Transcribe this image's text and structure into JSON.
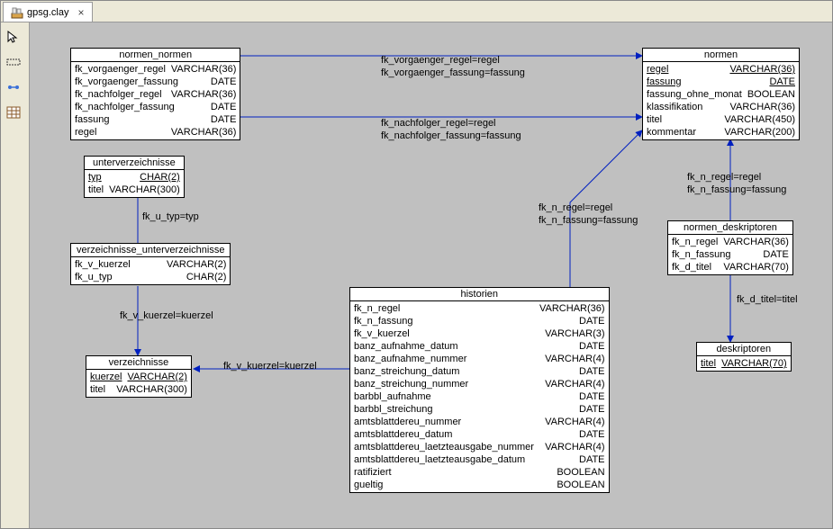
{
  "tab": {
    "title": "gpsg.clay",
    "close_label": "×"
  },
  "toolbar": {
    "pointer": "pointer-tool",
    "marquee": "marquee-tool",
    "link": "link-tool",
    "table": "table-tool"
  },
  "entities": {
    "normen_normen": {
      "title": "normen_normen",
      "rows": [
        {
          "name": "fk_vorgaenger_regel",
          "type": "VARCHAR(36)",
          "pk": false
        },
        {
          "name": "fk_vorgaenger_fassung",
          "type": "DATE",
          "pk": false
        },
        {
          "name": "fk_nachfolger_regel",
          "type": "VARCHAR(36)",
          "pk": false
        },
        {
          "name": "fk_nachfolger_fassung",
          "type": "DATE",
          "pk": false
        },
        {
          "name": "fassung",
          "type": "DATE",
          "pk": false
        },
        {
          "name": "regel",
          "type": "VARCHAR(36)",
          "pk": false
        }
      ]
    },
    "normen": {
      "title": "normen",
      "rows": [
        {
          "name": "regel",
          "type": "VARCHAR(36)",
          "pk": true
        },
        {
          "name": "fassung",
          "type": "DATE",
          "pk": true
        },
        {
          "name": "fassung_ohne_monat",
          "type": "BOOLEAN",
          "pk": false
        },
        {
          "name": "klassifikation",
          "type": "VARCHAR(36)",
          "pk": false
        },
        {
          "name": "titel",
          "type": "VARCHAR(450)",
          "pk": false
        },
        {
          "name": "kommentar",
          "type": "VARCHAR(200)",
          "pk": false
        }
      ]
    },
    "unterverzeichnisse": {
      "title": "unterverzeichnisse",
      "rows": [
        {
          "name": "typ",
          "type": "CHAR(2)",
          "pk": true
        },
        {
          "name": "titel",
          "type": "VARCHAR(300)",
          "pk": false
        }
      ]
    },
    "verzeichnisse_unterverzeichnisse": {
      "title": "verzeichnisse_unterverzeichnisse",
      "rows": [
        {
          "name": "fk_v_kuerzel",
          "type": "VARCHAR(2)",
          "pk": false
        },
        {
          "name": "fk_u_typ",
          "type": "CHAR(2)",
          "pk": false
        }
      ]
    },
    "verzeichnisse": {
      "title": "verzeichnisse",
      "rows": [
        {
          "name": "kuerzel",
          "type": "VARCHAR(2)",
          "pk": true
        },
        {
          "name": "titel",
          "type": "VARCHAR(300)",
          "pk": false
        }
      ]
    },
    "normen_deskriptoren": {
      "title": "normen_deskriptoren",
      "rows": [
        {
          "name": "fk_n_regel",
          "type": "VARCHAR(36)",
          "pk": false
        },
        {
          "name": "fk_n_fassung",
          "type": "DATE",
          "pk": false
        },
        {
          "name": "fk_d_titel",
          "type": "VARCHAR(70)",
          "pk": false
        }
      ]
    },
    "deskriptoren": {
      "title": "deskriptoren",
      "rows": [
        {
          "name": "titel",
          "type": "VARCHAR(70)",
          "pk": true
        }
      ]
    },
    "historien": {
      "title": "historien",
      "rows": [
        {
          "name": "fk_n_regel",
          "type": "VARCHAR(36)",
          "pk": false
        },
        {
          "name": "fk_n_fassung",
          "type": "DATE",
          "pk": false
        },
        {
          "name": "fk_v_kuerzel",
          "type": "VARCHAR(3)",
          "pk": false
        },
        {
          "name": "banz_aufnahme_datum",
          "type": "DATE",
          "pk": false
        },
        {
          "name": "banz_aufnahme_nummer",
          "type": "VARCHAR(4)",
          "pk": false
        },
        {
          "name": "banz_streichung_datum",
          "type": "DATE",
          "pk": false
        },
        {
          "name": "banz_streichung_nummer",
          "type": "VARCHAR(4)",
          "pk": false
        },
        {
          "name": "barbbl_aufnahme",
          "type": "DATE",
          "pk": false
        },
        {
          "name": "barbbl_streichung",
          "type": "DATE",
          "pk": false
        },
        {
          "name": "amtsblattdereu_nummer",
          "type": "VARCHAR(4)",
          "pk": false
        },
        {
          "name": "amtsblattdereu_datum",
          "type": "DATE",
          "pk": false
        },
        {
          "name": "amtsblattdereu_laetzteausgabe_nummer",
          "type": "VARCHAR(4)",
          "pk": false
        },
        {
          "name": "amtsblattdereu_laetzteausgabe_datum",
          "type": "DATE",
          "pk": false
        },
        {
          "name": "ratifiziert",
          "type": "BOOLEAN",
          "pk": false
        },
        {
          "name": "gueltig",
          "type": "BOOLEAN",
          "pk": false
        }
      ]
    }
  },
  "rel_labels": {
    "r1a": "fk_vorgaenger_regel=regel",
    "r1b": "fk_vorgaenger_fassung=fassung",
    "r2a": "fk_nachfolger_regel=regel",
    "r2b": "fk_nachfolger_fassung=fassung",
    "r3": "fk_u_typ=typ",
    "r4": "fk_v_kuerzel=kuerzel",
    "r5": "fk_v_kuerzel=kuerzel",
    "r6a": "fk_n_regel=regel",
    "r6b": "fk_n_fassung=fassung",
    "r7a": "fk_n_regel=regel",
    "r7b": "fk_n_fassung=fassung",
    "r8": "fk_d_titel=titel"
  }
}
